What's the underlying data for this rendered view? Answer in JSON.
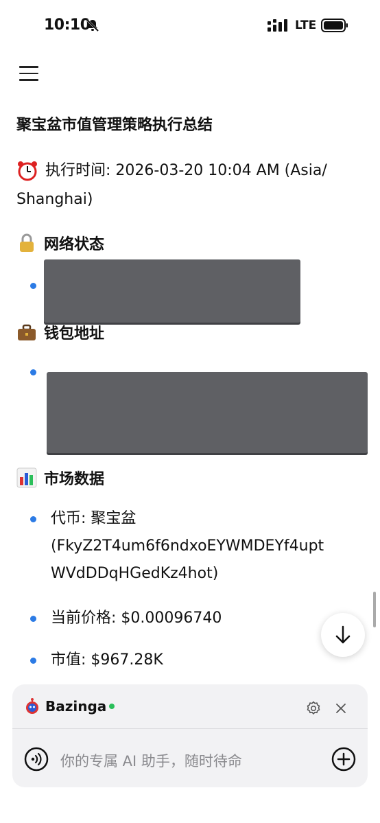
{
  "status_bar": {
    "time": "10:10",
    "network": "LTE"
  },
  "document": {
    "title": "聚宝盆市值管理策略执行总结",
    "exec_time_line1": "执行时间: 2026-03-20 10:04 AM (Asia/",
    "exec_time_line2": "Shanghai)",
    "sections": {
      "network": "网络状态",
      "wallet": "钱包地址",
      "market": "市场数据"
    },
    "market_items": {
      "token_line1": "代币: 聚宝盆",
      "token_line2": "(FkyZ2T4um6f6ndxoEYWMDEYf4upt",
      "token_line3": "WVdDDqHGedKz4hot)",
      "price": "当前价格: $0.00096740",
      "market_cap": "市值: $967.28K"
    }
  },
  "assistant": {
    "name": "Bazinga",
    "status_color": "#2bbf5a",
    "placeholder": "你的专属 AI 助手，随时待命"
  },
  "colors": {
    "accent": "#2c7be5",
    "redaction": "#5f6064"
  }
}
